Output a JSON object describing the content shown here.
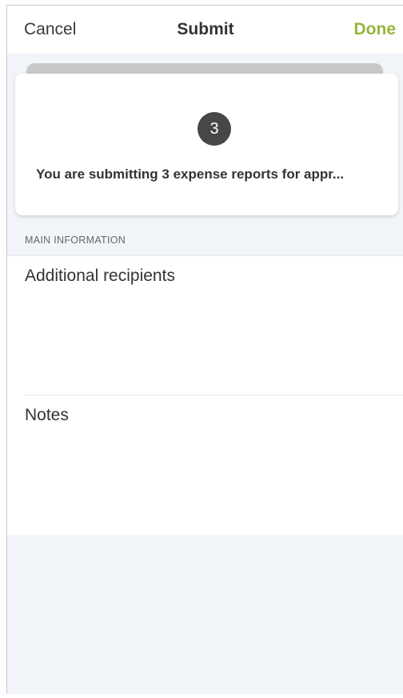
{
  "navbar": {
    "cancel_label": "Cancel",
    "title": "Submit",
    "done_label": "Done"
  },
  "summary_card": {
    "count": "3",
    "message": "You are submitting 3 expense reports for appr..."
  },
  "sections": {
    "main_header": "MAIN INFORMATION"
  },
  "fields": {
    "recipients_label": "Additional recipients",
    "notes_label": "Notes"
  },
  "colors": {
    "accent": "#94b63b",
    "background": "#f1f5f9",
    "badge": "#474747"
  }
}
